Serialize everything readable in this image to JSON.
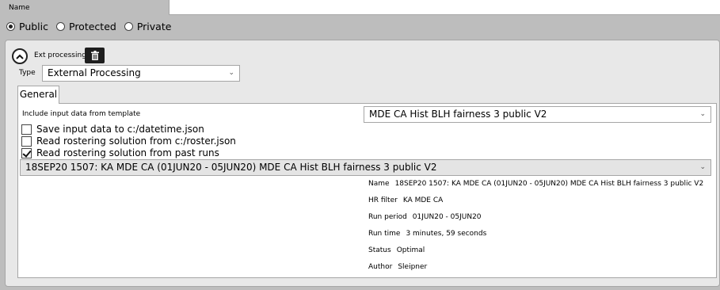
{
  "header": {
    "name_label": "Name",
    "name_value": ""
  },
  "visibility": {
    "selected": "Public",
    "options": [
      "Public",
      "Protected",
      "Private"
    ]
  },
  "ext_processing": {
    "label": "Ext processing",
    "type_label": "Type",
    "type_value": "External Processing",
    "tab_general": "General",
    "include_label": "Include input data from template",
    "template_value": "MDE CA Hist BLH fairness 3 public V2",
    "checkboxes": [
      {
        "label": "Save input data to c:/datetime.json",
        "checked": false
      },
      {
        "label": "Read rostering solution from c:/roster.json",
        "checked": false
      },
      {
        "label": "Read rostering solution from past runs",
        "checked": true
      }
    ],
    "run_value": "18SEP20 1507: KA MDE CA (01JUN20 - 05JUN20) MDE CA Hist BLH fairness 3 public V2",
    "details": [
      {
        "key": "Name",
        "value": "18SEP20 1507: KA MDE CA (01JUN20 - 05JUN20) MDE CA Hist BLH fairness 3 public V2"
      },
      {
        "key": "HR filter",
        "value": "KA MDE CA"
      },
      {
        "key": "Run period",
        "value": "01JUN20 - 05JUN20"
      },
      {
        "key": "Run time",
        "value": "3 minutes, 59 seconds"
      },
      {
        "key": "Status",
        "value": "Optimal"
      },
      {
        "key": "Author",
        "value": "Sleipner"
      }
    ]
  },
  "icons": {
    "collapse": "chevron-up-icon",
    "delete": "trash-icon",
    "dropdown": "chevron-down-icon"
  }
}
